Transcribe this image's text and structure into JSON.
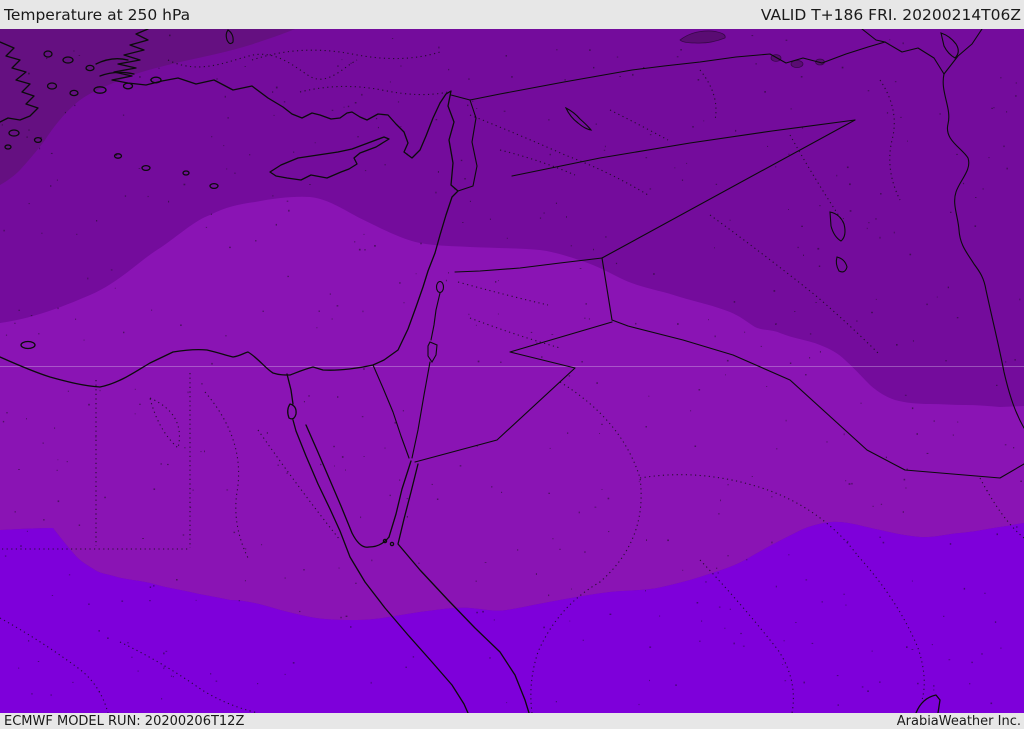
{
  "header": {
    "title": "Temperature at 250 hPa",
    "valid_label": "VALID T+186 FRI. 20200214T06Z"
  },
  "footer": {
    "model_run": "ECMWF MODEL RUN: 20200206T12Z",
    "credit": "ArabiaWeather Inc."
  },
  "map": {
    "parameter": "Temperature at 250 hPa",
    "model": "ECMWF",
    "colors": {
      "band_dark": "#740c9c",
      "band_medium": "#8a14b4",
      "band_bright": "#7e00da",
      "band_corner_dark": "#651081",
      "band_darkest_spot": "#5a0c73",
      "coastline": "#0b0b0b",
      "bar_background": "#e7e7e7",
      "bar_text": "#1a1a1a"
    }
  }
}
